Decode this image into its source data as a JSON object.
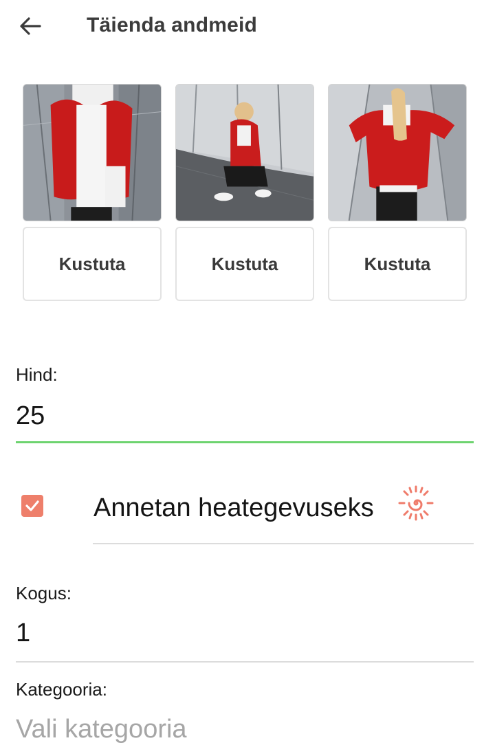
{
  "header": {
    "title": "Täienda andmeid",
    "back_icon": "arrow-left-icon"
  },
  "photos": [
    {
      "delete_label": "Kustuta"
    },
    {
      "delete_label": "Kustuta"
    },
    {
      "delete_label": "Kustuta"
    }
  ],
  "price": {
    "label": "Hind:",
    "value": "25",
    "accent_color": "#6dd36f"
  },
  "charity": {
    "checked": true,
    "label": "Annetan heategevuseks",
    "icon": "sun-icon",
    "accent_color": "#ee7f6b"
  },
  "quantity": {
    "label": "Kogus:",
    "value": "1"
  },
  "category": {
    "label": "Kategooria:",
    "placeholder": "Vali kategooria"
  }
}
